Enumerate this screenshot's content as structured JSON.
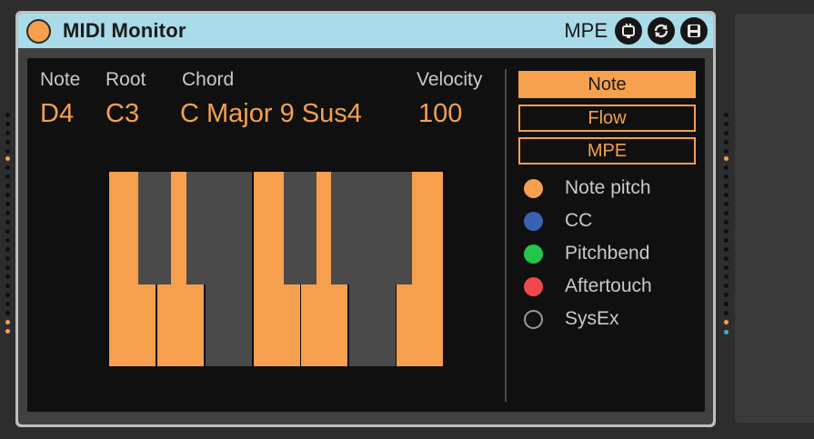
{
  "device": {
    "title": "MIDI Monitor",
    "mpe_label": "MPE",
    "icons": [
      "midi-plug-icon",
      "refresh-icon",
      "save-icon"
    ]
  },
  "readout": {
    "note_header": "Note",
    "root_header": "Root",
    "chord_header": "Chord",
    "velocity_header": "Velocity",
    "note_value": "D4",
    "root_value": "C3",
    "chord_value": "C Major 9 Sus4",
    "velocity_value": "100"
  },
  "keyboard": {
    "white_keys_active": [
      true,
      true,
      false,
      true,
      true,
      false,
      true
    ],
    "black_keys_active": [
      false,
      false,
      false,
      false,
      false
    ],
    "active_color": "#f6a04d",
    "inactive_white_color": "#4a4a4a",
    "inactive_black_color": "#4a4a4a"
  },
  "modes": {
    "note_label": "Note",
    "flow_label": "Flow",
    "mpe_label": "MPE",
    "selected": "Note"
  },
  "legend": [
    {
      "label": "Note pitch",
      "color": "#f6a04d",
      "style": "filled"
    },
    {
      "label": "CC",
      "color": "#3a62b4",
      "style": "filled"
    },
    {
      "label": "Pitchbend",
      "color": "#22c648",
      "style": "filled"
    },
    {
      "label": "Aftertouch",
      "color": "#ee4a4a",
      "style": "filled"
    },
    {
      "label": "SysEx",
      "color": "#9a9a9a",
      "style": "outline"
    }
  ],
  "colors": {
    "accent": "#f6a04d",
    "titlebar": "#a9dbe8"
  }
}
